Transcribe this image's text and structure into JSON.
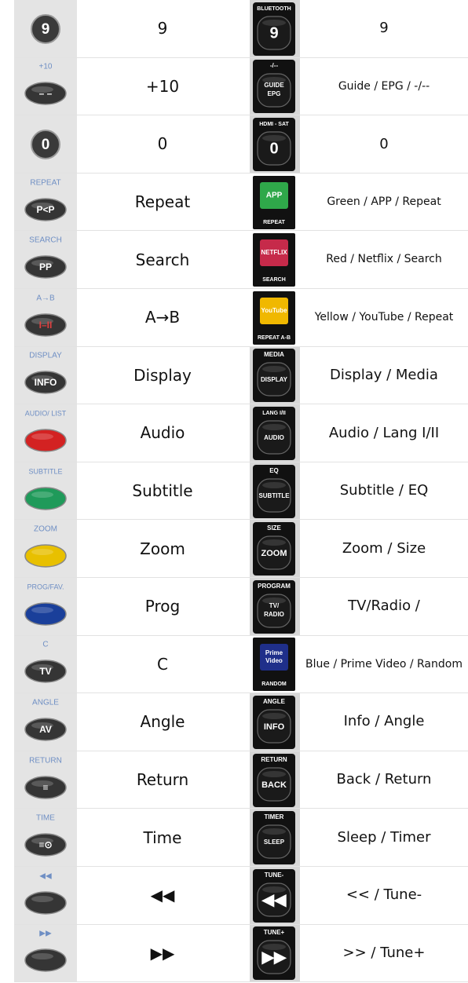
{
  "rows": [
    {
      "left_icon": "digit-9-button-icon",
      "left_badge": "",
      "left_key": "9",
      "left_label": "9",
      "right_icon": "bluetooth-9-key-icon",
      "right_badge": "BLUETOOTH",
      "right_key": "9",
      "right_label": "9"
    },
    {
      "left_icon": "plus10-dash-button-icon",
      "left_badge": "+10",
      "left_key": "– –",
      "left_label": "+10",
      "right_icon": "guide-epg-key-icon",
      "right_badge": "-/--",
      "right_key": "GUIDE",
      "right_key2": "EPG",
      "right_label": "Guide / EPG / -/--"
    },
    {
      "left_icon": "digit-0-button-icon",
      "left_badge": "",
      "left_key": "0",
      "left_label": "0",
      "right_icon": "hdmi-sat-0-key-icon",
      "right_badge": "HDMI - SAT",
      "right_key": "0",
      "right_label": "0"
    },
    {
      "left_icon": "repeat-pp-button-icon",
      "left_badge": "REPEAT",
      "left_key": "P<P",
      "left_label": "Repeat",
      "right_icon": "green-app-key-icon",
      "right_badge": "REPEAT",
      "right_key": "APP",
      "right_label": "Green / APP / Repeat"
    },
    {
      "left_icon": "search-pp-button-icon",
      "left_badge": "SEARCH",
      "left_key": "PP",
      "left_label": "Search",
      "right_icon": "red-netflix-key-icon",
      "right_badge": "SEARCH",
      "right_key": "NETFLIX",
      "right_label": "Red / Netflix / Search"
    },
    {
      "left_icon": "ab-repeat-button-icon",
      "left_badge": "A→B",
      "left_key": "I–II",
      "left_label": "A→B",
      "right_icon": "yellow-youtube-key-icon",
      "right_badge": "REPEAT A-B",
      "right_key": "YouTube",
      "right_label": "Yellow / YouTube / Repeat"
    },
    {
      "left_icon": "display-info-button-icon",
      "left_badge": "DISPLAY",
      "left_key": "INFO",
      "left_label": "Display",
      "right_icon": "media-display-key-icon",
      "right_badge": "MEDIA",
      "right_key": "DISPLAY",
      "right_label": "Display / Media"
    },
    {
      "left_icon": "audio-red-button-icon",
      "left_badge": "AUDIO/ LIST",
      "left_key": "",
      "left_label": "Audio",
      "right_icon": "lang-audio-key-icon",
      "right_badge": "LANG I/II",
      "right_key": "AUDIO",
      "right_label": "Audio / Lang I/II"
    },
    {
      "left_icon": "subtitle-green-button-icon",
      "left_badge": "SUBTITLE",
      "left_key": "",
      "left_label": "Subtitle",
      "right_icon": "eq-subtitle-key-icon",
      "right_badge": "EQ",
      "right_key": "SUBTITLE",
      "right_label": "Subtitle / EQ"
    },
    {
      "left_icon": "zoom-yellow-button-icon",
      "left_badge": "ZOOM",
      "left_key": "",
      "left_label": "Zoom",
      "right_icon": "size-zoom-key-icon",
      "right_badge": "SIZE",
      "right_key": "ZOOM",
      "right_label": "Zoom / Size"
    },
    {
      "left_icon": "prog-blue-button-icon",
      "left_badge": "PROG/FAV.",
      "left_key": "",
      "left_label": "Prog",
      "right_icon": "program-tv-radio-key-icon",
      "right_badge": "PROGRAM",
      "right_key": "TV/",
      "right_key2": "RADIO",
      "right_label": "TV/Radio /"
    },
    {
      "left_icon": "c-tv-button-icon",
      "left_badge": "C",
      "left_key": "TV",
      "left_label": "C",
      "right_icon": "blue-prime-video-key-icon",
      "right_badge": "RANDOM",
      "right_key": "Prime",
      "right_key2": "Video",
      "right_label": "Blue / Prime Video / Random"
    },
    {
      "left_icon": "angle-av-button-icon",
      "left_badge": "ANGLE",
      "left_key": "AV",
      "left_label": "Angle",
      "right_icon": "angle-info-key-icon",
      "right_badge": "ANGLE",
      "right_key": "INFO",
      "right_label": "Info / Angle"
    },
    {
      "left_icon": "return-menu-button-icon",
      "left_badge": "RETURN",
      "left_key": "≡",
      "left_label": "Return",
      "right_icon": "return-back-key-icon",
      "right_badge": "RETURN",
      "right_key": "BACK",
      "right_label": "Back / Return"
    },
    {
      "left_icon": "time-button-icon",
      "left_badge": "TIME",
      "left_key": "≡⊙",
      "left_label": "Time",
      "right_icon": "timer-sleep-key-icon",
      "right_badge": "TIMER",
      "right_key": "SLEEP",
      "right_label": "Sleep / Timer"
    },
    {
      "left_icon": "rewind-button-icon",
      "left_badge": "◀◀",
      "left_key": "",
      "left_label": "◀◀",
      "right_icon": "tune-minus-rewind-key-icon",
      "right_badge": "TUNE-",
      "right_key": "◀◀",
      "right_label": "<< / Tune-"
    },
    {
      "left_icon": "fast-forward-button-icon",
      "left_badge": "▶▶",
      "left_key": "",
      "left_label": "▶▶",
      "right_icon": "tune-plus-forward-key-icon",
      "right_badge": "TUNE+",
      "right_key": "▶▶",
      "right_label": ">> / Tune+"
    }
  ],
  "colors": {
    "left_cell_bg": "#e4e4e4",
    "right_cell_bg": "#d7d7d7",
    "left_badge_text": "#6f8fc4",
    "left_button_dark": "#353535",
    "red": "#d32222",
    "green": "#1f9a5a",
    "yellow": "#e8c000",
    "blue": "#1a3f9a",
    "key_black": "#111111",
    "app_green": "#2fa84a",
    "netflix_red": "#c62a4a",
    "youtube_yellow": "#f0b800",
    "prime_blue": "#1f2f8a"
  }
}
